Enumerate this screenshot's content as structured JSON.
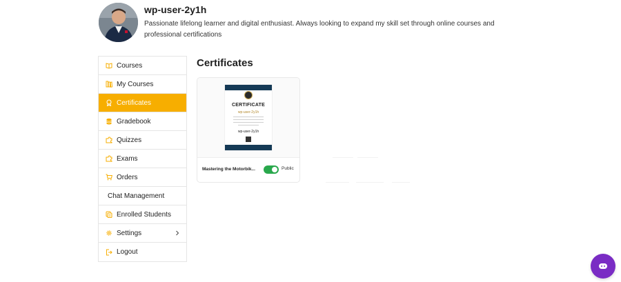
{
  "profile": {
    "username": "wp-user-2y1h",
    "bio": "Passionate lifelong learner and digital enthusiast. Always looking to expand my skill set through online courses and professional certifications"
  },
  "sidebar": {
    "items": [
      {
        "label": "Courses",
        "icon": "book-open-icon"
      },
      {
        "label": "My Courses",
        "icon": "books-icon"
      },
      {
        "label": "Certificates",
        "icon": "award-icon",
        "active": true
      },
      {
        "label": "Gradebook",
        "icon": "database-icon"
      },
      {
        "label": "Quizzes",
        "icon": "puzzle-icon"
      },
      {
        "label": "Exams",
        "icon": "puzzle-icon"
      },
      {
        "label": "Orders",
        "icon": "cart-icon"
      },
      {
        "label": "Chat Management",
        "icon": ""
      },
      {
        "label": "Enrolled Students",
        "icon": "students-icon"
      },
      {
        "label": "Settings",
        "icon": "gear-icon",
        "has_submenu": true
      },
      {
        "label": "Logout",
        "icon": "logout-icon"
      }
    ]
  },
  "main": {
    "title": "Certificates",
    "certificates": [
      {
        "name": "Mastering the Motorbik...",
        "public": true,
        "public_label": "Public",
        "preview": {
          "heading": "CERTIFICATE",
          "recipient": "wp-user-2y1h"
        }
      }
    ]
  },
  "colors": {
    "accent": "#f7ae00",
    "toggle_on": "#29a84c",
    "chat_button": "#7a2cc4",
    "certificate_band": "#153a56"
  },
  "chat_widget": {
    "icon": "chat-bubble-icon"
  }
}
